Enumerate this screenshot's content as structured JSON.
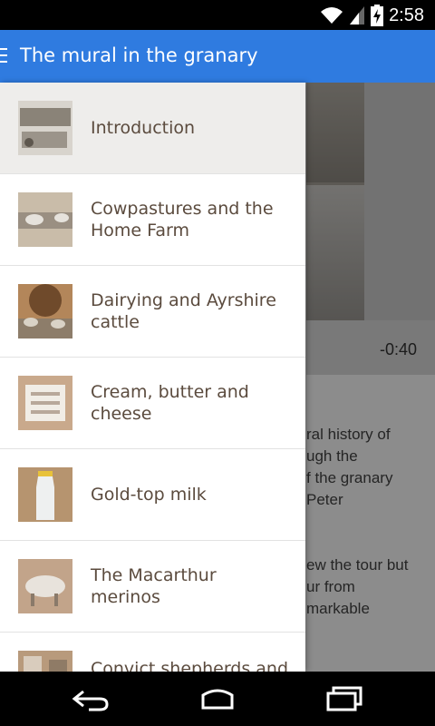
{
  "status_bar": {
    "time": "2:58"
  },
  "app_bar": {
    "title": "The mural in the granary"
  },
  "drawer": {
    "items": [
      {
        "label": "Introduction",
        "selected": true
      },
      {
        "label": "Cowpastures and the Home Farm",
        "line1": "Cowpastures and the",
        "line2": "Home Farm"
      },
      {
        "label": "Dairying and Ayrshire cattle",
        "line1": "Dairying and Ayrshire",
        "line2": "cattle"
      },
      {
        "label": "Cream, butter and cheese",
        "line1": "Cream, butter and",
        "line2": "cheese"
      },
      {
        "label": "Gold-top milk"
      },
      {
        "label": "The Macarthur merinos",
        "line1": "The Macarthur",
        "line2": "merinos"
      },
      {
        "label": "Convict shepherds and"
      }
    ]
  },
  "content": {
    "player_time": "-0:40",
    "text_lines": [
      "ral history of",
      "ugh the",
      "f the granary",
      "Peter",
      "ew the tour but",
      "ur from",
      "markable"
    ]
  }
}
